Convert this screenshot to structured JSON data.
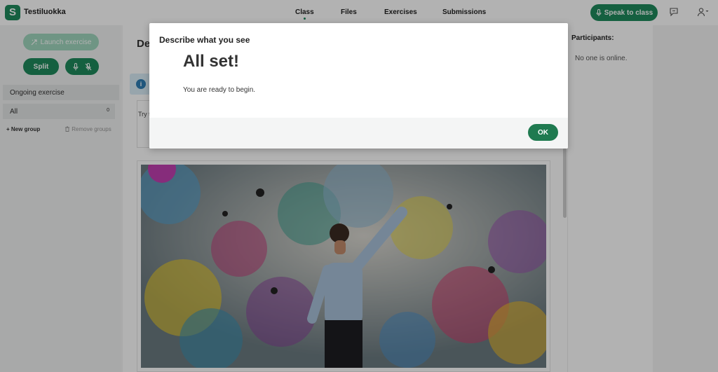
{
  "topbar": {
    "app_name": "Testiluokka",
    "logo_letter": "S",
    "nav": [
      "Class",
      "Files",
      "Exercises",
      "Submissions"
    ],
    "active_nav": "Class",
    "speak_label": "Speak to class"
  },
  "sidebar": {
    "launch_label": "Launch exercise",
    "split_label": "Split",
    "ongoing_label": "Ongoing exercise",
    "all_label": "All",
    "all_count": "0",
    "new_group_label": "New group",
    "remove_groups_label": "Remove groups"
  },
  "main": {
    "title_partial": "De",
    "card_text_partial": "Try t"
  },
  "participants": {
    "title": "Participants:",
    "status": "No one is online."
  },
  "modal": {
    "header": "Describe what you see",
    "title": "All set!",
    "message": "You are ready to begin.",
    "ok_label": "OK"
  },
  "colors": {
    "accent": "#1f8a5c",
    "accent_light": "#9fd6bd",
    "info_bg": "#d8ecf6",
    "overlay": "rgba(0,0,0,0.30)"
  },
  "icons": [
    "mic-icon",
    "mic-off-icon",
    "chat-icon",
    "user-icon",
    "launch-icon",
    "info-icon",
    "trash-icon",
    "plus-icon"
  ]
}
